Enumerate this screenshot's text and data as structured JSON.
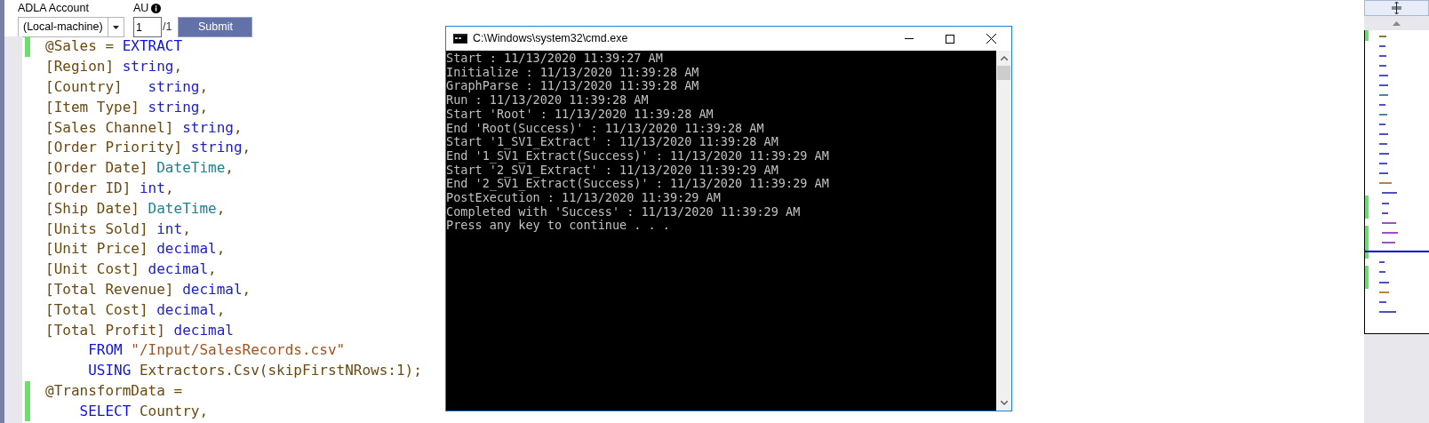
{
  "toolbar": {
    "account_label": "ADLA Account",
    "account_value": "(Local-machine)",
    "au_label": "AU",
    "au_value": "1",
    "au_max": "/1",
    "submit": "Submit"
  },
  "editor": {
    "lines": [
      {
        "changed": true,
        "tokens": [
          {
            "kind": "plain",
            "text": "@Sales = "
          },
          {
            "kind": "keyword",
            "text": "EXTRACT"
          }
        ]
      },
      {
        "changed": false,
        "tokens": [
          {
            "kind": "plain",
            "text": "[Region] "
          },
          {
            "kind": "type",
            "text": "string"
          },
          {
            "kind": "plain",
            "text": ","
          }
        ]
      },
      {
        "changed": false,
        "tokens": [
          {
            "kind": "plain",
            "text": "[Country]   "
          },
          {
            "kind": "type",
            "text": "string"
          },
          {
            "kind": "plain",
            "text": ","
          }
        ]
      },
      {
        "changed": false,
        "tokens": [
          {
            "kind": "plain",
            "text": "[Item Type] "
          },
          {
            "kind": "type",
            "text": "string"
          },
          {
            "kind": "plain",
            "text": ","
          }
        ]
      },
      {
        "changed": false,
        "tokens": [
          {
            "kind": "plain",
            "text": "[Sales Channel] "
          },
          {
            "kind": "type",
            "text": "string"
          },
          {
            "kind": "plain",
            "text": ","
          }
        ]
      },
      {
        "changed": false,
        "tokens": [
          {
            "kind": "plain",
            "text": "[Order Priority] "
          },
          {
            "kind": "type",
            "text": "string"
          },
          {
            "kind": "plain",
            "text": ","
          }
        ]
      },
      {
        "changed": false,
        "tokens": [
          {
            "kind": "plain",
            "text": "[Order Date] "
          },
          {
            "kind": "class",
            "text": "DateTime"
          },
          {
            "kind": "plain",
            "text": ","
          }
        ]
      },
      {
        "changed": false,
        "tokens": [
          {
            "kind": "plain",
            "text": "[Order ID] "
          },
          {
            "kind": "type",
            "text": "int"
          },
          {
            "kind": "plain",
            "text": ","
          }
        ]
      },
      {
        "changed": false,
        "tokens": [
          {
            "kind": "plain",
            "text": "[Ship Date] "
          },
          {
            "kind": "class",
            "text": "DateTime"
          },
          {
            "kind": "plain",
            "text": ","
          }
        ]
      },
      {
        "changed": false,
        "tokens": [
          {
            "kind": "plain",
            "text": "[Units Sold] "
          },
          {
            "kind": "type",
            "text": "int"
          },
          {
            "kind": "plain",
            "text": ","
          }
        ]
      },
      {
        "changed": false,
        "tokens": [
          {
            "kind": "plain",
            "text": "[Unit Price] "
          },
          {
            "kind": "type",
            "text": "decimal"
          },
          {
            "kind": "plain",
            "text": ","
          }
        ]
      },
      {
        "changed": false,
        "tokens": [
          {
            "kind": "plain",
            "text": "[Unit Cost] "
          },
          {
            "kind": "type",
            "text": "decimal"
          },
          {
            "kind": "plain",
            "text": ","
          }
        ]
      },
      {
        "changed": false,
        "tokens": [
          {
            "kind": "plain",
            "text": "[Total Revenue] "
          },
          {
            "kind": "type",
            "text": "decimal"
          },
          {
            "kind": "plain",
            "text": ","
          }
        ]
      },
      {
        "changed": false,
        "tokens": [
          {
            "kind": "plain",
            "text": "[Total Cost] "
          },
          {
            "kind": "type",
            "text": "decimal"
          },
          {
            "kind": "plain",
            "text": ","
          }
        ]
      },
      {
        "changed": false,
        "tokens": [
          {
            "kind": "plain",
            "text": "[Total Profit] "
          },
          {
            "kind": "type",
            "text": "decimal"
          }
        ]
      },
      {
        "changed": false,
        "tokens": [
          {
            "kind": "keyword",
            "text": "     FROM "
          },
          {
            "kind": "string",
            "text": "\"/Input/SalesRecords.csv\""
          }
        ]
      },
      {
        "changed": false,
        "tokens": [
          {
            "kind": "keyword",
            "text": "     USING "
          },
          {
            "kind": "plain",
            "text": "Extractors.Csv(skipFirstNRows:1);"
          }
        ]
      },
      {
        "changed": true,
        "tokens": [
          {
            "kind": "plain",
            "text": "@TransformData ="
          }
        ]
      },
      {
        "changed": true,
        "tokens": [
          {
            "kind": "keyword",
            "text": "    SELECT "
          },
          {
            "kind": "plain",
            "text": "Country,"
          }
        ]
      }
    ]
  },
  "console": {
    "title": "C:\\Windows\\system32\\cmd.exe",
    "lines": [
      "Start : 11/13/2020 11:39:27 AM",
      "Initialize : 11/13/2020 11:39:28 AM",
      "GraphParse : 11/13/2020 11:39:28 AM",
      "Run : 11/13/2020 11:39:28 AM",
      "Start 'Root' : 11/13/2020 11:39:28 AM",
      "End 'Root(Success)' : 11/13/2020 11:39:28 AM",
      "Start '1_SV1_Extract' : 11/13/2020 11:39:28 AM",
      "End '1_SV1_Extract(Success)' : 11/13/2020 11:39:29 AM",
      "Start '2_SV1_Extract' : 11/13/2020 11:39:29 AM",
      "End '2_SV1_Extract(Success)' : 11/13/2020 11:39:29 AM",
      "PostExecution : 11/13/2020 11:39:29 AM",
      "Completed with 'Success' : 11/13/2020 11:39:29 AM",
      "Press any key to continue . . ."
    ]
  }
}
